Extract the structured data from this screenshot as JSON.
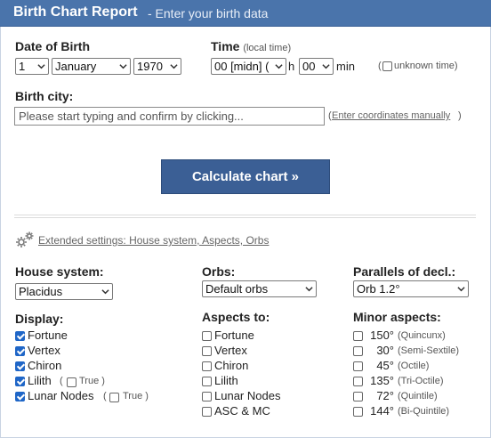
{
  "header": {
    "title": "Birth Chart Report",
    "subtitle": "- Enter your birth data"
  },
  "dob": {
    "label": "Date of Birth",
    "day": "1",
    "month": "January",
    "year": "1970"
  },
  "time": {
    "label": "Time",
    "note": "(local time)",
    "hour": "00 [midn] (",
    "h_label": "h",
    "minute": "00",
    "min_label": "min",
    "unknown_label": "unknown time"
  },
  "city": {
    "label": "Birth city:",
    "placeholder": "Please start typing and confirm by clicking...",
    "manual_link": "Enter coordinates manually"
  },
  "calculate_label": "Calculate chart »",
  "extended_link": "Extended settings: House system, Aspects, Orbs",
  "house_system": {
    "label": "House system:",
    "value": "Placidus"
  },
  "orbs": {
    "label": "Orbs:",
    "value": "Default orbs"
  },
  "parallels": {
    "label": "Parallels of decl.:",
    "value": "Orb 1.2°"
  },
  "display": {
    "label": "Display:",
    "items": [
      {
        "label": "Fortune",
        "checked": true
      },
      {
        "label": "Vertex",
        "checked": true
      },
      {
        "label": "Chiron",
        "checked": true
      },
      {
        "label": "Lilith",
        "checked": true,
        "sub": "True"
      },
      {
        "label": "Lunar Nodes",
        "checked": true,
        "sub": "True"
      }
    ]
  },
  "aspects_to": {
    "label": "Aspects to:",
    "items": [
      "Fortune",
      "Vertex",
      "Chiron",
      "Lilith",
      "Lunar Nodes",
      "ASC & MC"
    ]
  },
  "minor_aspects": {
    "label": "Minor aspects:",
    "items": [
      {
        "deg": "150°",
        "name": "(Quincunx)"
      },
      {
        "deg": "30°",
        "name": "(Semi-Sextile)"
      },
      {
        "deg": "45°",
        "name": "(Octile)"
      },
      {
        "deg": "135°",
        "name": "(Tri-Octile)"
      },
      {
        "deg": "72°",
        "name": "(Quintile)"
      },
      {
        "deg": "144°",
        "name": "(Bi-Quintile)"
      }
    ]
  },
  "colors": {
    "header_bg": "#4a74ab",
    "button_bg": "#3b5f95",
    "checkbox_on": "#1f66c7"
  }
}
